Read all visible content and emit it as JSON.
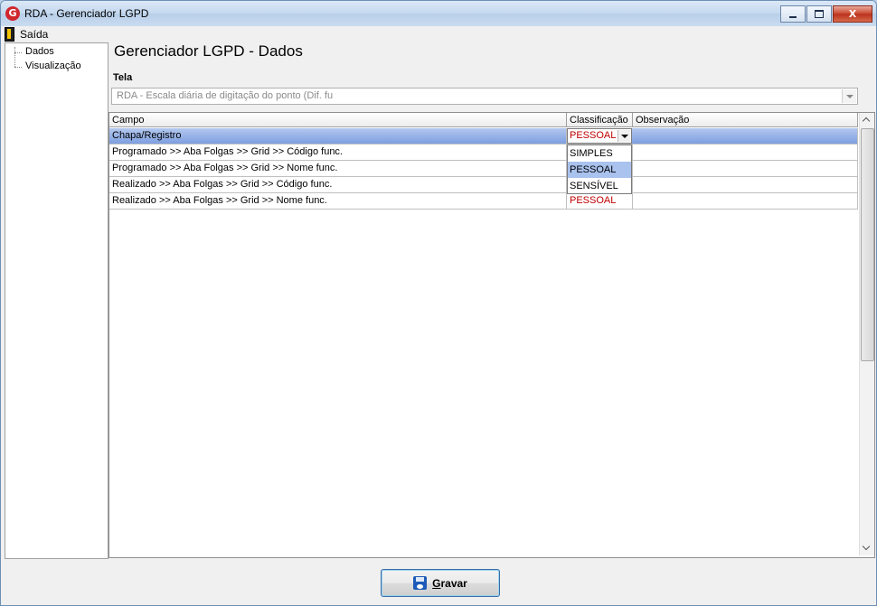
{
  "window": {
    "title": "RDA - Gerenciador LGPD",
    "app_icon_letter": "G",
    "close_glyph": "X"
  },
  "menu": {
    "exit_label": "Saída"
  },
  "tree": {
    "items": [
      "Dados",
      "Visualização"
    ]
  },
  "page": {
    "title": "Gerenciador LGPD - Dados"
  },
  "tela": {
    "label": "Tela",
    "value": "RDA - Escala diária de digitação do ponto (Dif. fu"
  },
  "grid": {
    "columns": [
      "Campo",
      "Classificação",
      "Observação"
    ],
    "rows": [
      {
        "campo": "Chapa/Registro",
        "classificacao": "PESSOAL",
        "observacao": ""
      },
      {
        "campo": "Programado >> Aba Folgas >> Grid >> Código func.",
        "classificacao": "",
        "observacao": ""
      },
      {
        "campo": "Programado >> Aba Folgas >> Grid >> Nome func.",
        "classificacao": "",
        "observacao": ""
      },
      {
        "campo": "Realizado >> Aba Folgas >> Grid >> Código func.",
        "classificacao": "",
        "observacao": ""
      },
      {
        "campo": "Realizado >> Aba Folgas >> Grid >> Nome func.",
        "classificacao": "PESSOAL",
        "observacao": ""
      }
    ],
    "dropdown_options": [
      "SIMPLES",
      "PESSOAL",
      "SENSÍVEL"
    ],
    "dropdown_highlighted": "PESSOAL"
  },
  "save_button": {
    "label_underlined": "G",
    "label_rest": "ravar"
  },
  "colors": {
    "selected_row": "#7d9ee0",
    "classification_text": "#c00000",
    "save_icon": "#1e5bb8"
  }
}
